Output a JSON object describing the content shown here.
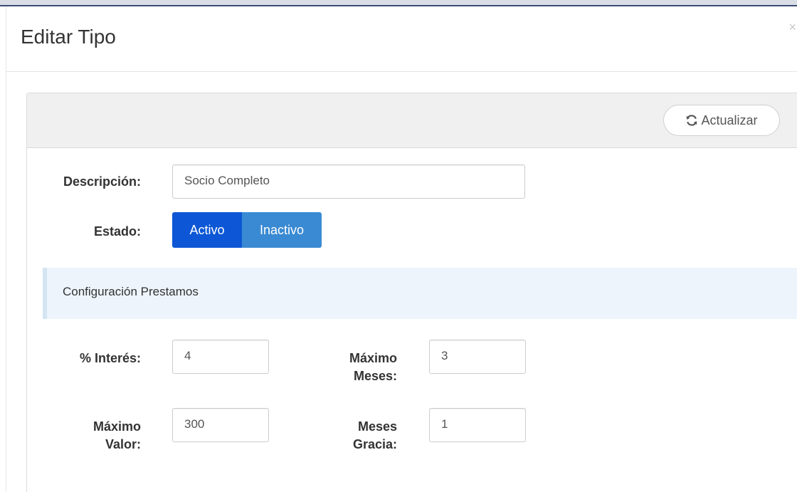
{
  "modal": {
    "title": "Editar Tipo",
    "close_label": "×"
  },
  "toolbar": {
    "update_label": "Actualizar",
    "update_icon": "refresh-icon"
  },
  "form": {
    "description_label": "Descripción:",
    "description_value": "Socio Completo",
    "state_label": "Estado:",
    "state_options": [
      "Activo",
      "Inactivo"
    ],
    "state_selected": "Activo"
  },
  "loan_config": {
    "section_title": "Configuración Prestamos",
    "interest_label": "% Interés:",
    "interest_value": "4",
    "max_months_label_line1": "Máximo",
    "max_months_label_line2": "Meses:",
    "max_months_value": "3",
    "max_value_label_line1": "Máximo",
    "max_value_label_line2": "Valor:",
    "max_value_value": "300",
    "grace_months_label_line1": "Meses",
    "grace_months_label_line2": "Gracia:",
    "grace_months_value": "1"
  },
  "colors": {
    "toggle_active": "#0d57d6",
    "toggle_inactive": "#3a8ad3",
    "section_band": "#edf4fb"
  }
}
